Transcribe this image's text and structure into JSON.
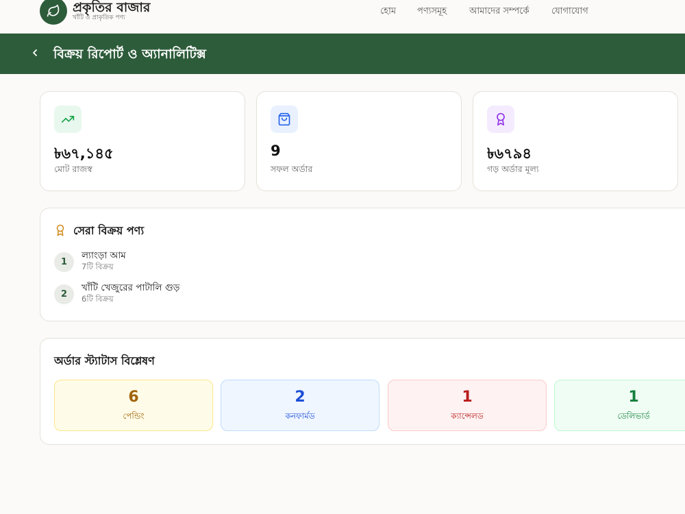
{
  "header": {
    "brand_title": "প্রকৃতির বাজার",
    "brand_subtitle": "খাঁটি ও প্রাকৃতিক পণ্য",
    "nav": [
      {
        "label": "হোম"
      },
      {
        "label": "পণ্যসমূহ"
      },
      {
        "label": "আমাদের সম্পর্কে"
      },
      {
        "label": "যোগাযোগ"
      }
    ]
  },
  "banner": {
    "title": "বিক্রয় রিপোর্ট ও অ্যানালিটিক্স"
  },
  "stats": [
    {
      "value": "৳৬৭,১৪৫",
      "label": "মোট রাজস্ব",
      "icon": "trending-up-icon",
      "color": "#16a34a",
      "bg": "#e9f8ee"
    },
    {
      "value": "9",
      "label": "সফল অর্ডার",
      "icon": "shopping-bag-icon",
      "color": "#2563eb",
      "bg": "#e9f1ff"
    },
    {
      "value": "৳৬৭৯৪",
      "label": "গড় অর্ডার মূল্য",
      "icon": "award-icon",
      "color": "#9333ea",
      "bg": "#f4ecfe"
    }
  ],
  "top_products": {
    "title": "সেরা বিক্রয় পণ্য",
    "icon_color": "#d08a1a",
    "items": [
      {
        "rank": "1",
        "name": "ল্যাংড়া আম",
        "sales": "7টি বিক্রয়"
      },
      {
        "rank": "2",
        "name": "খাঁটি খেজুরের পাটালি গুড়",
        "sales": "6টি বিক্রয়"
      }
    ]
  },
  "order_status": {
    "title": "অর্ডার স্ট্যাটাস বিশ্লেষণ",
    "items": [
      {
        "count": "6",
        "label": "পেন্ডিং",
        "color": "#a16207",
        "bg": "#fefce8",
        "border": "#fde68a"
      },
      {
        "count": "2",
        "label": "কনফার্মড",
        "color": "#1d4ed8",
        "bg": "#eff6ff",
        "border": "#bfdbfe"
      },
      {
        "count": "1",
        "label": "ক্যান্সেলড",
        "color": "#b91c1c",
        "bg": "#fef2f2",
        "border": "#fecaca"
      },
      {
        "count": "1",
        "label": "ডেলিভার্ড",
        "color": "#15803d",
        "bg": "#f0fdf4",
        "border": "#bbf7d0"
      }
    ]
  }
}
